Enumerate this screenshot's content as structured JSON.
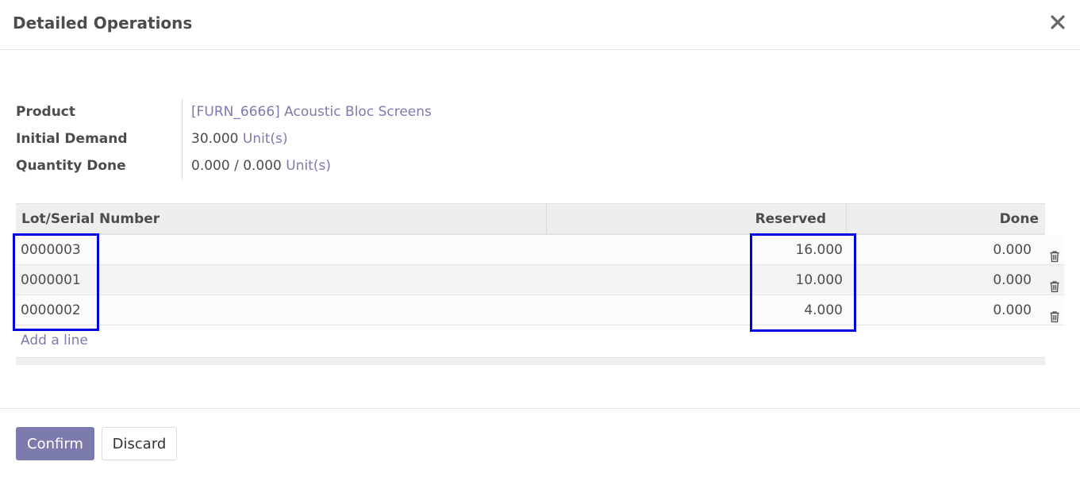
{
  "dialog": {
    "title": "Detailed Operations",
    "close_icon": "close-icon"
  },
  "info": {
    "product_label": "Product",
    "product_value": "[FURN_6666] Acoustic Bloc Screens",
    "initial_demand_label": "Initial Demand",
    "initial_demand_qty": "30.000",
    "initial_demand_uom": "Unit(s)",
    "quantity_done_label": "Quantity Done",
    "quantity_done_qty": "0.000 / 0.000",
    "quantity_done_uom": "Unit(s)"
  },
  "table": {
    "headers": {
      "lot": "Lot/Serial Number",
      "reserved": "Reserved",
      "done": "Done"
    },
    "rows": [
      {
        "lot": "0000003",
        "reserved": "16.000",
        "done": "0.000"
      },
      {
        "lot": "0000001",
        "reserved": "10.000",
        "done": "0.000"
      },
      {
        "lot": "0000002",
        "reserved": "4.000",
        "done": "0.000"
      }
    ],
    "add_line": "Add a line",
    "row_action_icon": "trash-icon"
  },
  "footer": {
    "confirm_label": "Confirm",
    "discard_label": "Discard"
  },
  "colors": {
    "primary": "#7c7bad",
    "link": "#7c7bad",
    "highlight": "#0000e0"
  }
}
